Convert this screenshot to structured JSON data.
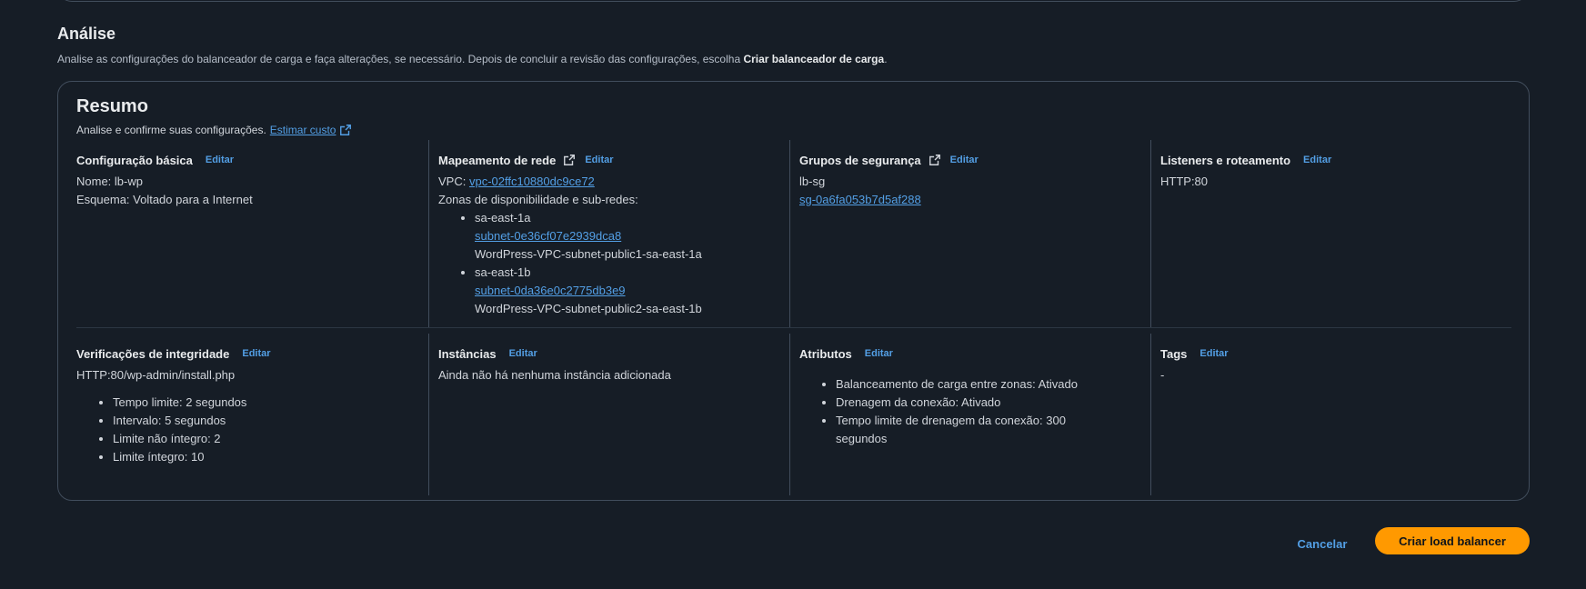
{
  "section": {
    "title": "Análise",
    "description_pre": "Analise as configurações do balanceador de carga e faça alterações, se necessário. Depois de concluir a revisão das configurações, escolha ",
    "description_bold": "Criar balanceador de carga",
    "description_post": "."
  },
  "summary": {
    "title": "Resumo",
    "subtitle": "Analise e confirme suas configurações.",
    "estimate_link": "Estimar custo",
    "edit_label": "Editar"
  },
  "basic": {
    "heading": "Configuração básica",
    "name": "Nome: lb-wp",
    "scheme": "Esquema: Voltado para a Internet"
  },
  "network": {
    "heading": "Mapeamento de rede",
    "vpc_label": "VPC:",
    "vpc_link": "vpc-02ffc10880dc9ce72",
    "zones_label": "Zonas de disponibilidade e sub-redes:",
    "zones": [
      {
        "zone": "sa-east-1a",
        "subnet": "subnet-0e36cf07e2939dca8",
        "subnet_name": "WordPress-VPC-subnet-public1-sa-east-1a"
      },
      {
        "zone": "sa-east-1b",
        "subnet": "subnet-0da36e0c2775db3e9",
        "subnet_name": "WordPress-VPC-subnet-public2-sa-east-1b"
      }
    ]
  },
  "security": {
    "heading": "Grupos de segurança",
    "group_name": "lb-sg",
    "group_link": "sg-0a6fa053b7d5af288"
  },
  "listeners": {
    "heading": "Listeners e roteamento",
    "value": "HTTP:80"
  },
  "health": {
    "heading": "Verificações de integridade",
    "path": "HTTP:80/wp-admin/install.php",
    "items": [
      "Tempo limite: 2 segundos",
      "Intervalo: 5 segundos",
      "Limite não íntegro: 2",
      "Limite íntegro: 10"
    ]
  },
  "instances": {
    "heading": "Instâncias",
    "value": "Ainda não há nenhuma instância adicionada"
  },
  "attributes": {
    "heading": "Atributos",
    "items": [
      "Balanceamento de carga entre zonas: Ativado",
      "Drenagem da conexão: Ativado",
      "Tempo limite de drenagem da conexão: 300 segundos"
    ]
  },
  "tags": {
    "heading": "Tags",
    "value": "-"
  },
  "actions": {
    "cancel": "Cancelar",
    "create": "Criar load balancer"
  },
  "colors": {
    "background": "#161d26",
    "link": "#539fe5",
    "primary_button": "#ff9900",
    "border": "#414d5c"
  }
}
